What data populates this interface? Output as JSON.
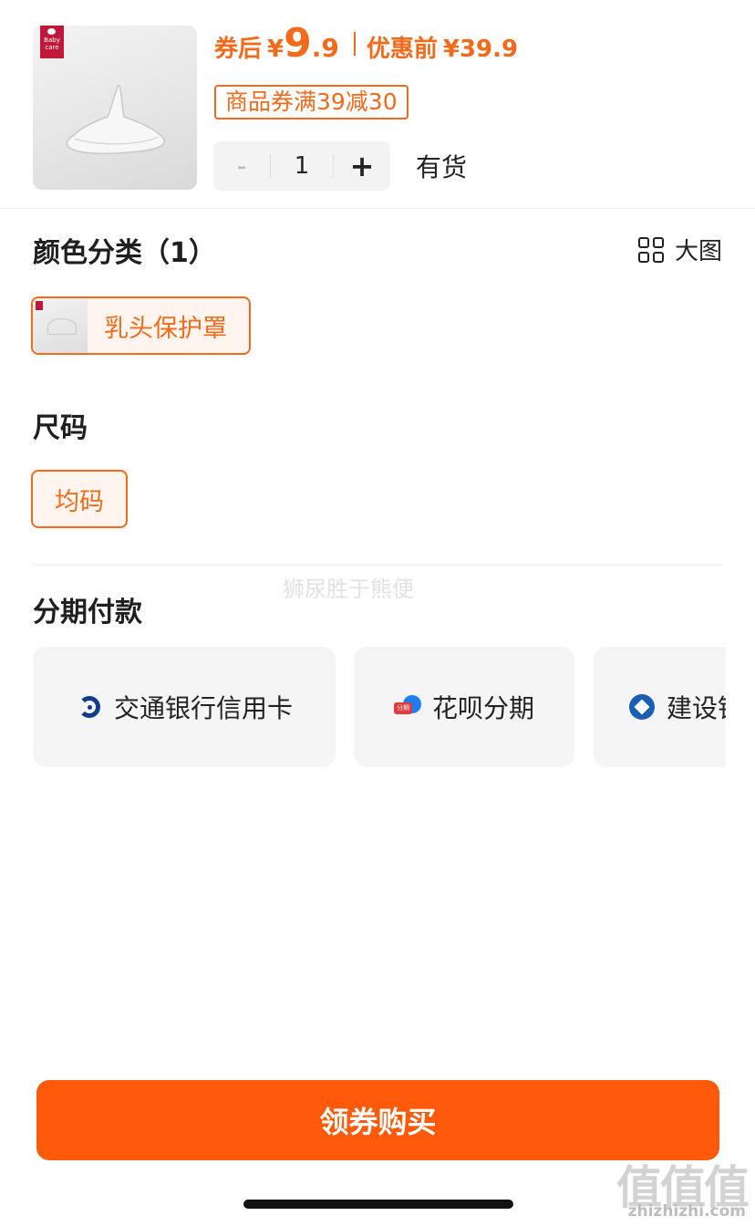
{
  "product": {
    "brand_logo_text": "Baby care",
    "price_label": "券后",
    "currency": "¥",
    "price_int": "9",
    "price_dec": ".9",
    "original_label": "优惠前",
    "original_price": "¥39.9",
    "coupon": "商品券满39减30",
    "quantity": "1",
    "minus": "-",
    "plus": "+",
    "stock": "有货"
  },
  "color_section": {
    "title": "颜色分类（1）",
    "big_view_label": "大图",
    "options": [
      {
        "label": "乳头保护罩",
        "selected": true
      }
    ]
  },
  "size_section": {
    "title": "尺码",
    "options": [
      {
        "label": "均码",
        "selected": true
      }
    ]
  },
  "watermark": "狮尿胜于熊便",
  "installment_section": {
    "title": "分期付款",
    "cards": [
      {
        "label": "交通银行信用卡",
        "icon": "bocom-icon"
      },
      {
        "label": "花呗分期",
        "icon": "huabei-icon",
        "icon_text": "分期"
      },
      {
        "label": "建设银",
        "icon": "ccb-icon"
      }
    ]
  },
  "buy_button": "领券购买",
  "site_watermark": {
    "logo": "值值值",
    "url": "zhizhizhi.com"
  },
  "colors": {
    "accent": "#f26a1b",
    "button": "#ff5a0a",
    "chip_bg": "#fff5ee"
  }
}
